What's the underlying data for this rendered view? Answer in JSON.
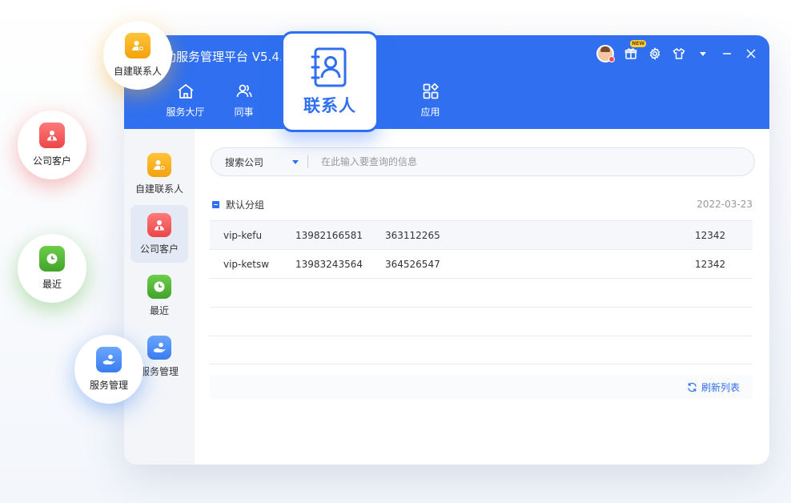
{
  "app": {
    "title": "助服务管理平台 V5.4."
  },
  "titlebar": {
    "new_badge": "NEW",
    "icons": [
      "avatar-icon",
      "gift-icon",
      "settings-icon",
      "skin-icon",
      "dropdown-icon",
      "minimize-icon",
      "close-icon"
    ]
  },
  "nav": {
    "items": [
      {
        "label": "服务大厅",
        "icon": "home-icon"
      },
      {
        "label": "同事",
        "icon": "colleagues-icon"
      },
      {
        "label": "应用",
        "icon": "apps-icon"
      }
    ],
    "active": {
      "label": "联系人",
      "icon": "contacts-book-icon"
    }
  },
  "sidebar": {
    "items": [
      {
        "label": "自建联系人",
        "icon": "self-contact-icon",
        "color": "#f4a20c"
      },
      {
        "label": "公司客户",
        "icon": "company-customer-icon",
        "color": "#ec4646",
        "active": true
      },
      {
        "label": "最近",
        "icon": "recent-clock-icon",
        "color": "#40a42a"
      },
      {
        "label": "服务管理",
        "icon": "service-manage-icon",
        "color": "#3a7cf0"
      }
    ]
  },
  "search": {
    "scope": "搜索公司",
    "placeholder": "在此输入要查询的信息"
  },
  "group": {
    "name": "默认分组",
    "date": "2022-03-23"
  },
  "table": {
    "rows": [
      {
        "name": "vip-kefu",
        "phone": "13982166581",
        "id": "363112265",
        "ext": "12342"
      },
      {
        "name": "vip-ketsw",
        "phone": "13983243564",
        "id": "364526547",
        "ext": "12342"
      }
    ]
  },
  "footer": {
    "refresh_label": "刷新列表"
  },
  "bubbles": [
    {
      "label": "自建联系人",
      "icon": "self-contact-icon"
    },
    {
      "label": "公司客户",
      "icon": "company-customer-icon"
    },
    {
      "label": "最近",
      "icon": "recent-clock-icon"
    },
    {
      "label": "服务管理",
      "icon": "service-manage-icon"
    }
  ],
  "colors": {
    "brand_blue": "#2f6ff0",
    "orange": "#f4a20c",
    "red": "#ec4646",
    "green": "#40a42a",
    "blue": "#3a7cf0"
  }
}
